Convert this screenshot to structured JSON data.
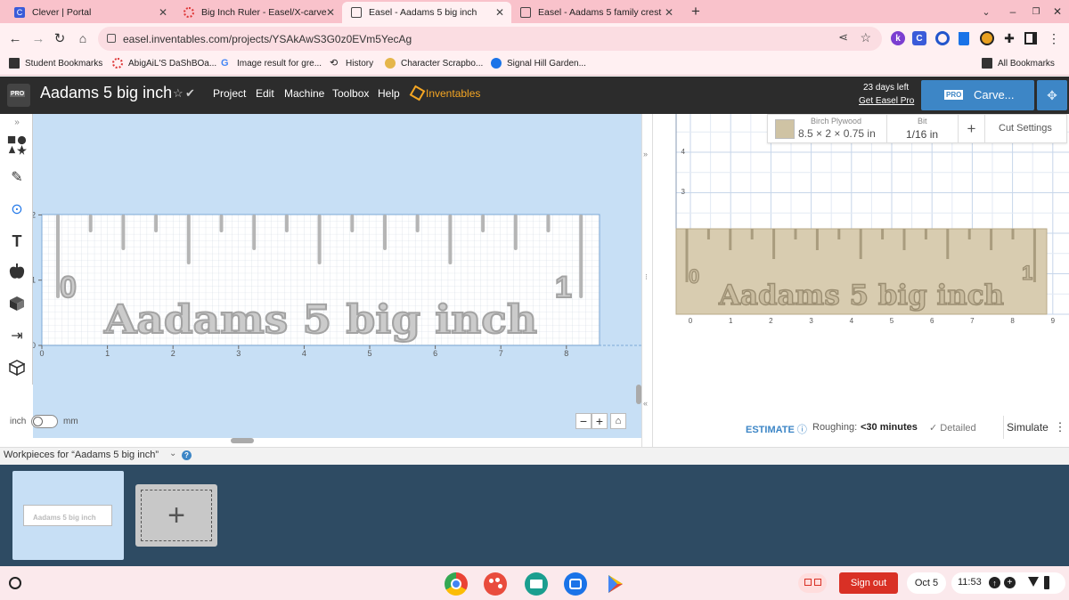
{
  "browser": {
    "tabs": [
      {
        "title": "Clever | Portal",
        "active": false
      },
      {
        "title": "Big Inch Ruler - Easel/X-carve",
        "active": false
      },
      {
        "title": "Easel - Aadams 5 big inch",
        "active": true
      },
      {
        "title": "Easel - Aadams 5 family crest",
        "active": false
      }
    ],
    "url": "easel.inventables.com/projects/YSAkAwS3G0z0EVm5YecAg",
    "bookmarks": [
      "Student Bookmarks",
      "AbigAiL'S DaShBOa...",
      "Image result for gre...",
      "History",
      "Character Scrapbo...",
      "Signal Hill Garden..."
    ],
    "all_bookmarks": "All Bookmarks",
    "ext_letters": [
      "k",
      "C"
    ]
  },
  "app": {
    "logo_badge": "PRO",
    "project_title": "Aadams 5 big inch",
    "menu": [
      "Project",
      "Edit",
      "Machine",
      "Toolbox",
      "Help",
      "Inventables"
    ],
    "trial_days": "23",
    "trial_text": "days left",
    "get_pro": "Get Easel Pro",
    "carve_badge": "PRO",
    "carve_label": "Carve..."
  },
  "design": {
    "unit_left": "inch",
    "unit_right": "mm",
    "x_ticks": [
      "0",
      "1",
      "2",
      "3",
      "4",
      "5",
      "6",
      "7",
      "8"
    ],
    "y_ticks": [
      "0",
      "1",
      "2"
    ],
    "ruler_zero": "0",
    "ruler_one": "1",
    "ruler_text": "Aadams 5 big inch",
    "zoom_minus": "−",
    "zoom_plus": "+"
  },
  "preview": {
    "material_name": "Birch Plywood",
    "material_size": "8.5 × 2 × 0.75 in",
    "bit_label": "Bit",
    "bit_value": "1/16 in",
    "cut_settings": "Cut Settings",
    "add": "+",
    "x_ticks": [
      "0",
      "1",
      "2",
      "3",
      "4",
      "5",
      "6",
      "7",
      "8",
      "9"
    ],
    "y_ticks": [
      "3",
      "4"
    ],
    "ruler_zero": "0",
    "ruler_one": "1",
    "ruler_text": "Aadams 5 big inch",
    "estimate": "ESTIMATE",
    "roughing_label": "Roughing:",
    "roughing_value": "<30 minutes",
    "detailed": "Detailed",
    "simulate": "Simulate"
  },
  "workpieces": {
    "label": "Workpieces for “Aadams 5 big inch”",
    "thumb_text": "Aadams 5 big inch"
  },
  "taskbar": {
    "sign_out": "Sign out",
    "date": "Oct 5",
    "time": "11:53"
  },
  "colors": {
    "accent_blue": "#3d86c6",
    "sign_out_red": "#d93025",
    "inventables_gold": "#f5a623"
  }
}
